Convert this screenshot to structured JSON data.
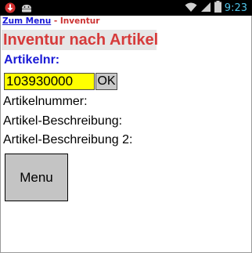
{
  "status_bar": {
    "time": "9:23",
    "icons": [
      "download-alert-icon",
      "android-icon",
      "wifi-icon",
      "signal-icon",
      "battery-icon"
    ]
  },
  "breadcrumb": {
    "home_link": "Zum Menu",
    "separator": " - ",
    "current": "Inventur"
  },
  "page": {
    "title": "Inventur nach Artikel"
  },
  "form": {
    "article_label": "Artikelnr:",
    "article_value": "103930000",
    "ok_label": "OK"
  },
  "details": {
    "article_number_label": "Artikelnummer:",
    "description_label": "Artikel-Beschreibung:",
    "description2_label": "Artikel-Beschreibung 2:"
  },
  "actions": {
    "menu_label": "Menu"
  },
  "colors": {
    "title_red": "#d63b3b",
    "label_blue": "#1a1ad6",
    "input_yellow": "#ffff00",
    "button_gray": "#c4c4c4"
  }
}
